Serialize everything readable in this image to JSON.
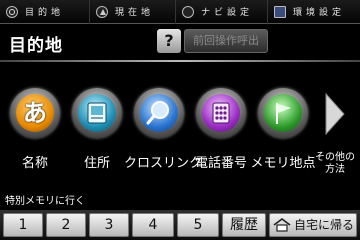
{
  "topbar": {
    "items": [
      {
        "label": "目的地",
        "icon": "search-icon"
      },
      {
        "label": "現在地",
        "icon": "compass-icon"
      },
      {
        "label": "ナビ設定",
        "icon": "nav-settings-icon"
      },
      {
        "label": "環境設定",
        "icon": "display-settings-icon"
      }
    ]
  },
  "header": {
    "title": "目的地",
    "help_label": "?",
    "prev_op_label": "前回操作呼出"
  },
  "search_methods": [
    {
      "label": "名称",
      "glyph": "あ",
      "icon": "hiragana-name-icon",
      "color": "#e88a00"
    },
    {
      "label": "住所",
      "icon": "address-book-icon",
      "color": "#1e8fb4"
    },
    {
      "label": "クロスリンク",
      "icon": "magnifier-icon",
      "color": "#2a74d0"
    },
    {
      "label": "電話番号",
      "icon": "phone-keypad-icon",
      "color": "#9b2cc4"
    },
    {
      "label": "メモリ地点",
      "icon": "flag-icon",
      "color": "#2e9c2a"
    }
  ],
  "more": {
    "line1": "その他の",
    "line2": "方法",
    "icon": "right-arrow-icon"
  },
  "memory": {
    "section_label": "特別メモリに行く",
    "buttons": [
      "1",
      "2",
      "3",
      "4",
      "5"
    ],
    "history_label": "履歴",
    "home_label": "自宅に帰る"
  }
}
